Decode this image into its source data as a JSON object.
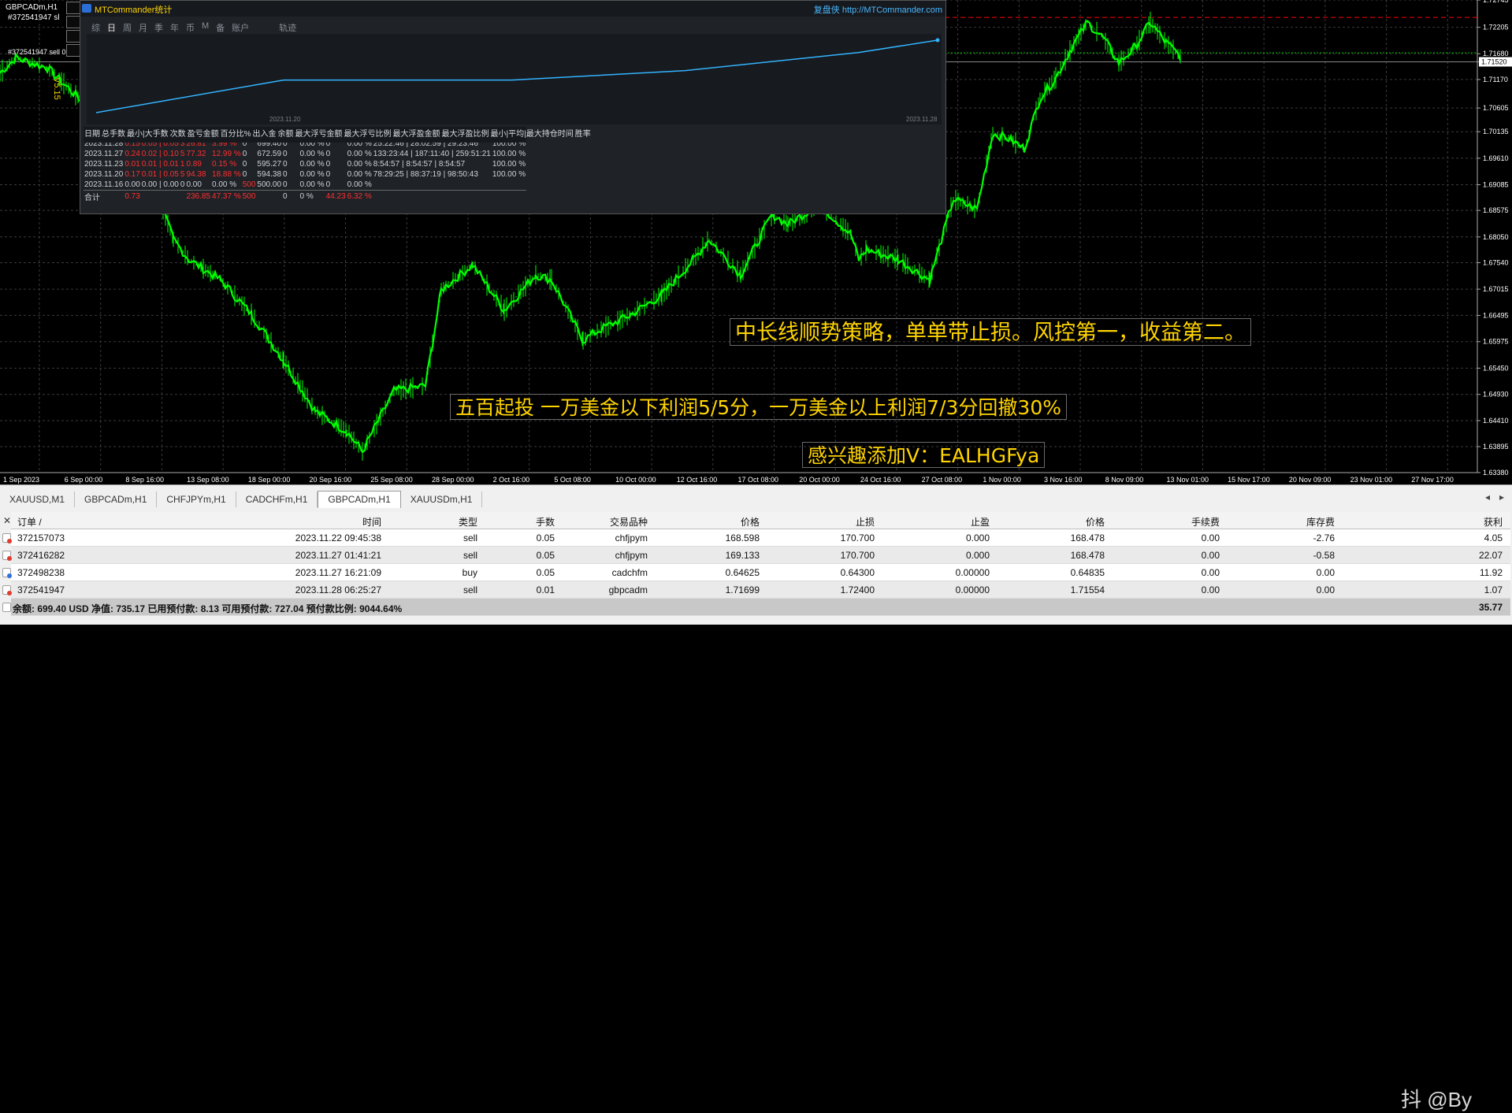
{
  "chart": {
    "symbol_line1": "GBPCADm,H1",
    "symbol_line2": "#372541947 sl",
    "order_label": "#372541947 sell 0.01",
    "vertical_label": "V5.15",
    "colors": {
      "background": "#000000",
      "candles": "#00ff00",
      "grid": "#3a3a3a",
      "axis": "#ffffff",
      "annotation": "#ffd400",
      "stop_line": "#ff0000",
      "tp_line": "#00c800"
    },
    "price_axis": [
      "1.72745",
      "1.72205",
      "1.71680",
      "1.71520",
      "1.71170",
      "1.70605",
      "1.70135",
      "1.69610",
      "1.69085",
      "1.68575",
      "1.68050",
      "1.67540",
      "1.67015",
      "1.66495",
      "1.65975",
      "1.65450",
      "1.64930",
      "1.64410",
      "1.63895",
      "1.63380"
    ],
    "current_price": "1.71520",
    "date_axis": [
      "1 Sep 2023",
      "6 Sep 00:00",
      "8 Sep 16:00",
      "13 Sep 08:00",
      "18 Sep 00:00",
      "20 Sep 16:00",
      "25 Sep 08:00",
      "28 Sep 00:00",
      "2 Oct 16:00",
      "5 Oct 08:00",
      "10 Oct 00:00",
      "12 Oct 16:00",
      "17 Oct 08:00",
      "20 Oct 00:00",
      "24 Oct 16:00",
      "27 Oct 08:00",
      "1 Nov 00:00",
      "3 Nov 16:00",
      "8 Nov 09:00",
      "13 Nov 01:00",
      "15 Nov 17:00",
      "20 Nov 09:00",
      "23 Nov 01:00",
      "27 Nov 17:00"
    ],
    "annotations": {
      "strategy": "中长线顺势策略，单单带止损。风控第一，收益第二。",
      "investment": "五百起投 一万美金以下利润5/5分，一万美金以上利润7/3分回撤30%",
      "contact": "感兴趣添加V：EALHGFya"
    }
  },
  "stats_panel": {
    "title": "MTCommander统计",
    "brand": "复盘侠 http://MTCommander.com",
    "tabs": [
      "综",
      "日",
      "周",
      "月",
      "季",
      "年",
      "币",
      "M",
      "备",
      "账户",
      "",
      "轨迹"
    ],
    "active_tab": "日",
    "date_start": "2023.11.20",
    "date_end": "2023.11.28",
    "equity_curve": [
      0.0,
      0.45,
      0.45,
      0.58,
      0.83,
      1.0
    ],
    "columns": [
      "日期",
      "总手数",
      "最小|大手数",
      "次数",
      "盈亏金额",
      "百分比%",
      "出入金",
      "余额",
      "最大浮亏金额",
      "最大浮亏比例",
      "最大浮盈金额",
      "最大浮盈比例",
      "最小|平均|最大持仓时间",
      "胜率"
    ],
    "rows": [
      [
        "持仓",
        "0.16",
        "0.01 | 0.05",
        "4",
        "37.45",
        "5.35 %",
        "0",
        "699.4",
        "0.00",
        "0.00 %",
        "44.23",
        "6.32 %",
        "6:19:33 | 52:11:36 | 146:59:22",
        ""
      ],
      [
        "2023.11.28",
        "0.15",
        "0.05 | 0.05",
        "3",
        "26.81",
        "3.99 %",
        "0",
        "699.40",
        "0",
        "0.00 %",
        "0",
        "0.00 %",
        "25:22:46 | 28:02:59 | 29:23:46",
        "100.00 %"
      ],
      [
        "2023.11.27",
        "0.24",
        "0.02 | 0.10",
        "5",
        "77.32",
        "12.99 %",
        "0",
        "672.59",
        "0",
        "0.00 %",
        "0",
        "0.00 %",
        "133:23:44 | 187:11:40 | 259:51:21",
        "100.00 %"
      ],
      [
        "2023.11.23",
        "0.01",
        "0.01 | 0.01",
        "1",
        "0.89",
        "0.15 %",
        "0",
        "595.27",
        "0",
        "0.00 %",
        "0",
        "0.00 %",
        "8:54:57 | 8:54:57 | 8:54:57",
        "100.00 %"
      ],
      [
        "2023.11.20",
        "0.17",
        "0.01 | 0.05",
        "5",
        "94.38",
        "18.88 %",
        "0",
        "594.38",
        "0",
        "0.00 %",
        "0",
        "0.00 %",
        "78:29:25 | 88:37:19 | 98:50:43",
        "100.00 %"
      ],
      [
        "2023.11.16",
        "0.00",
        "0.00 | 0.00",
        "0",
        "0.00",
        "0.00 %",
        "500",
        "500.00",
        "0",
        "0.00 %",
        "0",
        "0.00 %",
        "",
        ""
      ],
      [
        "合计",
        "0.73",
        "",
        "",
        "236.85",
        "47.37 %",
        "500",
        "",
        "0",
        "0 %",
        "44.23",
        "6.32 %",
        "",
        ""
      ]
    ]
  },
  "terminal": {
    "symbol_tabs": [
      "XAUUSD,M1",
      "GBPCADm,H1",
      "CHFJPYm,H1",
      "CADCHFm,H1",
      "GBPCADm,H1",
      "XAUUSDm,H1"
    ],
    "active_tab_index": 4,
    "columns": [
      "订单 /",
      "时间",
      "类型",
      "手数",
      "交易品种",
      "价格",
      "止损",
      "止盈",
      "价格",
      "手续费",
      "库存费",
      "获利"
    ],
    "orders": [
      {
        "id": "372157073",
        "time": "2023.11.22 09:45:38",
        "type": "sell",
        "lots": "0.05",
        "symbol": "chfjpym",
        "open_price": "168.598",
        "sl": "170.700",
        "tp": "0.000",
        "price": "168.478",
        "commission": "0.00",
        "swap": "-2.76",
        "profit": "4.05"
      },
      {
        "id": "372416282",
        "time": "2023.11.27 01:41:21",
        "type": "sell",
        "lots": "0.05",
        "symbol": "chfjpym",
        "open_price": "169.133",
        "sl": "170.700",
        "tp": "0.000",
        "price": "168.478",
        "commission": "0.00",
        "swap": "-0.58",
        "profit": "22.07"
      },
      {
        "id": "372498238",
        "time": "2023.11.27 16:21:09",
        "type": "buy",
        "lots": "0.05",
        "symbol": "cadchfm",
        "open_price": "0.64625",
        "sl": "0.64300",
        "tp": "0.00000",
        "price": "0.64835",
        "commission": "0.00",
        "swap": "0.00",
        "profit": "11.92"
      },
      {
        "id": "372541947",
        "time": "2023.11.28 06:25:27",
        "type": "sell",
        "lots": "0.01",
        "symbol": "gbpcadm",
        "open_price": "1.71699",
        "sl": "1.72400",
        "tp": "0.00000",
        "price": "1.71554",
        "commission": "0.00",
        "swap": "0.00",
        "profit": "1.07"
      }
    ],
    "summary": "余额: 699.40 USD  净值: 735.17  已用预付款: 8.13  可用预付款: 727.04  预付款比例: 9044.64%",
    "total_profit": "35.77",
    "watermark": "抖 @By"
  }
}
